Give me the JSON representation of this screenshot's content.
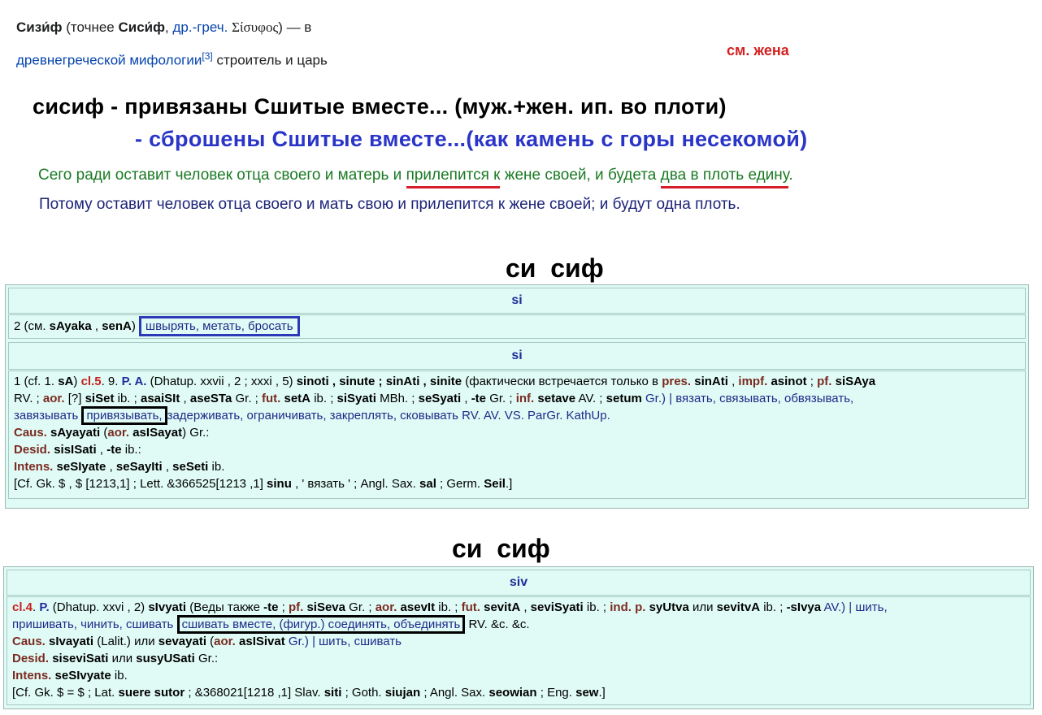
{
  "wiki": {
    "name_bold": "Сизи́ф",
    "paren_open": "(точнее",
    "name_alt_bold": "Сиси́ф",
    "comma": ",",
    "greek_link": "др.-греч.",
    "greek_word": "Σίσυφος",
    "close": ") — в",
    "myth_link": "древнегреческой мифологии",
    "ref": "[3]",
    "tail": "строитель и царь"
  },
  "red_note": "см. жена",
  "headline": {
    "line1": "сисиф - привязаны Сшитые вместе... (муж.+жен. ип. во плоти)",
    "line2": "- сброшены Сшитые вместе...(как камень с горы несекомой)"
  },
  "verse": {
    "v1_pre": "Сего ради оставит человек отца своего и матерь и",
    "v1_u1": "прилепится к",
    "v1_mid": "жене своей, и будета",
    "v1_u2": "два   в плоть едину",
    "v1_end": ".",
    "v2": "Потому оставит человек отца своего и мать свою и прилепится к жене своей; и будут одна  плоть."
  },
  "divider1": "си  сиф",
  "divider2": "си  сиф",
  "dict1": {
    "header1": "si",
    "row1_pre": "2 (см.",
    "row1_a": "sAyaka",
    "row1_sep": ",",
    "row1_b": "senA",
    "row1_close": ")",
    "row1_boxed": "швырять, метать, бросать",
    "header2": "si",
    "r2_l1_a": "1 (cf. 1.",
    "r2_l1_sA": "sA",
    "r2_l1_cl": "cl.5",
    "r2_l1_b": ". 9.",
    "r2_l1_PA": "P. A.",
    "r2_l1_c": "(Dhatup. xxvii , 2 ; xxxi , 5)",
    "r2_l1_forms": "sinoti , sinute ; sinAti , sinite",
    "r2_l1_d": "(фактически встречается только в",
    "r2_l1_pres": "pres.",
    "r2_l1_sinAti": "sinAti",
    "r2_l1_impf": "impf.",
    "r2_l1_asinot": "asinot",
    "r2_l1_pf": "pf.",
    "r2_l1_siSAya": "siSAya",
    "r2_l2_a": "RV. ;",
    "r2_l2_aor": "aor.",
    "r2_l2_b": "[?]",
    "r2_l2_siSet": "siSet",
    "r2_l2_c": "ib. ;",
    "r2_l2_asaiSIt": "asaiSIt",
    "r2_l2_d": ",",
    "r2_l2_aseSTa": "aseSTa",
    "r2_l2_e": "Gr. ;",
    "r2_l2_fut": "fut.",
    "r2_l2_setA": "setA",
    "r2_l2_f": "ib. ;",
    "r2_l2_siSyati": "siSyati",
    "r2_l2_g": "MBh. ;",
    "r2_l2_seSyati": "seSyati",
    "r2_l2_h": ",",
    "r2_l2_te": "-te",
    "r2_l2_i": "Gr. ;",
    "r2_l2_inf": "inf.",
    "r2_l2_setave": "setave",
    "r2_l2_j": "AV. ;",
    "r2_l2_setum": "setum",
    "r2_l2_k": "Gr.) | вязать, связывать, обвязывать,",
    "r2_l3_a": "завязывать",
    "r2_l3_boxed": "привязывать,",
    "r2_l3_b": "задерживать, ограничивать, закреплять, сковывать RV. AV. VS. ParGr. KathUp.",
    "caus_label": "Caus.",
    "caus_a": "sAyayati",
    "caus_b": "(",
    "caus_aor": "aor.",
    "caus_c": "asISayat",
    "caus_d": ") Gr.:",
    "desid_label": "Desid.",
    "desid_a": "sisISati",
    "desid_b": ",",
    "desid_c": "-te",
    "desid_d": "ib.:",
    "intens_label": "Intens.",
    "intens_a": "seSIyate",
    "intens_b": ",",
    "intens_c": "seSayIti",
    "intens_d": ",",
    "intens_e": "seSeti",
    "intens_f": "ib.",
    "cf_a": "[Cf. Gk. $ , $ [1213,1] ; Lett. &366525[1213 ,1]",
    "cf_sinu": "sinu",
    "cf_b": ", ' вязать ' ; Angl. Sax.",
    "cf_sal": "sal",
    "cf_c": "; Germ.",
    "cf_Seil": "Seil",
    "cf_d": ".]"
  },
  "dict2": {
    "header": "siv",
    "l1_cl": "cl.4",
    "l1_a": ".",
    "l1_P": "P.",
    "l1_b": "(Dhatup. xxvi , 2)",
    "l1_sIvyati": "sIvyati",
    "l1_c": "(Веды также",
    "l1_te": "-te",
    "l1_d": ";",
    "l1_pf": "pf.",
    "l1_siSeva": "siSeva",
    "l1_e": "Gr. ;",
    "l1_aor": "aor.",
    "l1_asevIt": "asevIt",
    "l1_f": "ib. ;",
    "l1_fut": "fut.",
    "l1_sevitA": "sevitA",
    "l1_g": ",",
    "l1_seviSyati": "seviSyati",
    "l1_h": "ib. ;",
    "l1_ind": "ind. p.",
    "l1_syUtva": "syUtva",
    "l1_i": "или",
    "l1_sevitvA": "sevitvA",
    "l1_j": "ib. ;",
    "l1_sIvya": "-sIvya",
    "l1_k": "AV.) | шить,",
    "l2_a": "пришивать, чинить, сшивать",
    "l2_boxed": "сшивать вместе, (фигур.) соединять, объединять",
    "l2_b": "RV. &c. &c.",
    "caus_label": "Caus.",
    "caus_a": "sIvayati",
    "caus_b": "(Lalit.) или",
    "caus_c": "sevayati",
    "caus_d": "(",
    "caus_aor": "aor.",
    "caus_e": "asISivat",
    "caus_f": "Gr.) | шить, сшивать",
    "desid_label": "Desid.",
    "desid_a": "siseviSati",
    "desid_b": "или",
    "desid_c": "susyUSati",
    "desid_d": "Gr.:",
    "intens_label": "Intens.",
    "intens_a": "seSIvyate",
    "intens_b": "ib.",
    "cf_a": "[Cf. Gk. $ = $ ; Lat.",
    "cf_suere": "suere sutor",
    "cf_b": "; &368021[1218 ,1] Slav.",
    "cf_siti": "siti",
    "cf_c": "; Goth.",
    "cf_siujan": "siujan",
    "cf_d": "; Angl. Sax.",
    "cf_seowian": "seowian",
    "cf_e": "; Eng.",
    "cf_sew": "sew",
    "cf_f": ".]"
  },
  "colors": {
    "headline_black": "#000000",
    "headline_blue": "#2a35c8",
    "verse_green": "#1a7a24",
    "verse_navy": "#1c2478",
    "underline_red": "#d41e2a",
    "panel_bg": "#e0fbf5",
    "grammar_brown": "#7a2a22",
    "class_red": "#c82020",
    "box_blue": "#2c3ab8"
  }
}
